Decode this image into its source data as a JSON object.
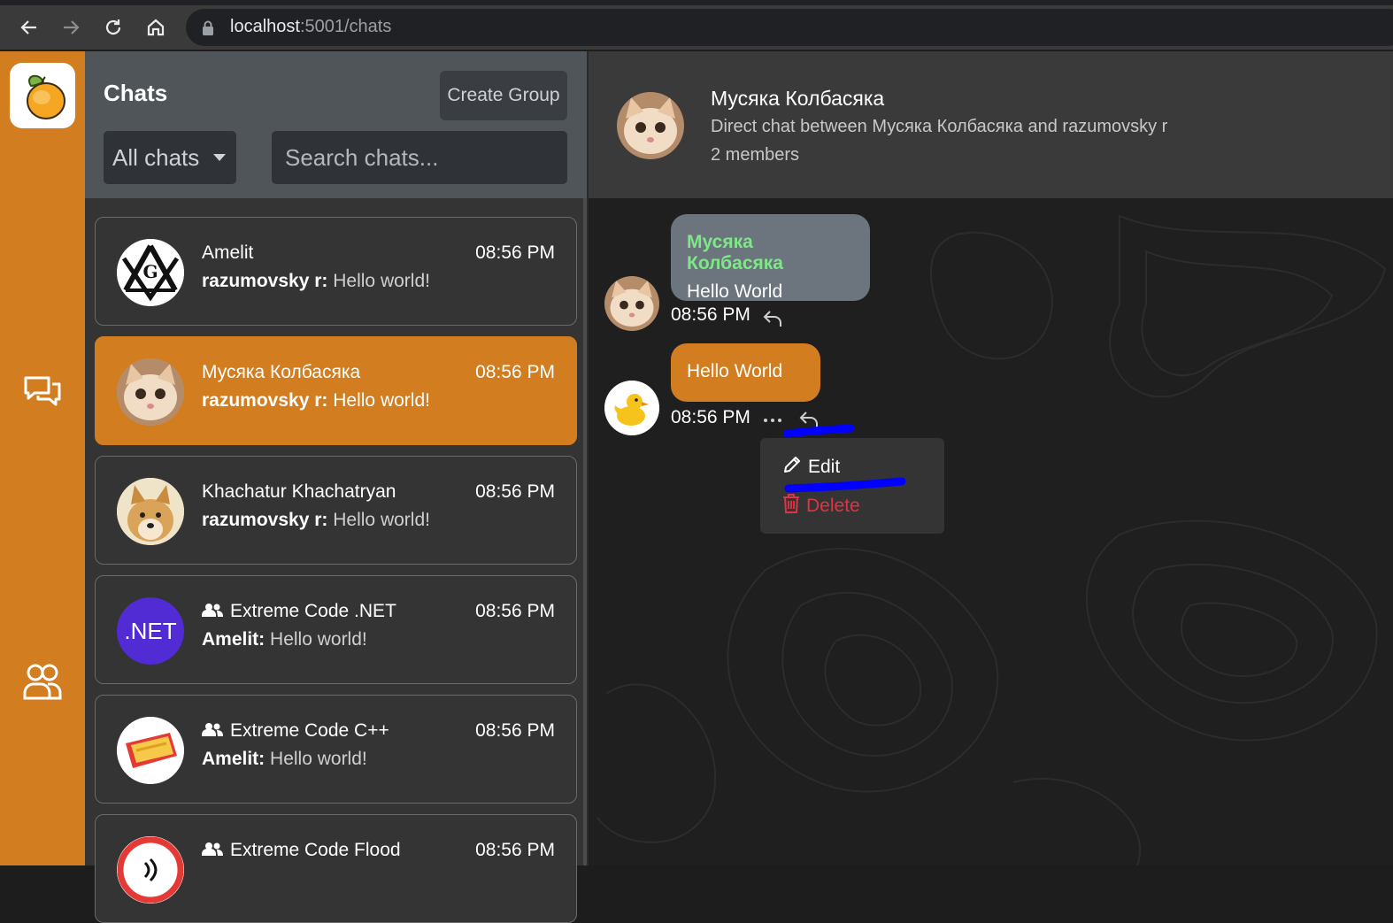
{
  "browser": {
    "url_host": "localhost",
    "url_path": ":5001/chats"
  },
  "sidebar": {
    "logo_icon": "mango-logo",
    "items": [
      {
        "icon": "chat-bubbles-icon"
      },
      {
        "icon": "people-icon"
      }
    ]
  },
  "chats": {
    "title": "Chats",
    "create_group_label": "Create Group",
    "filter_value": "All chats",
    "search_placeholder": "Search chats...",
    "list": [
      {
        "name": "Amelit",
        "time": "08:56 PM",
        "sender": "razumovsky r:",
        "message": "Hello world!",
        "group": false,
        "active": false
      },
      {
        "name": "Мусяка Колбасяка",
        "time": "08:56 PM",
        "sender": "razumovsky r:",
        "message": "Hello world!",
        "group": false,
        "active": true
      },
      {
        "name": "Khachatur Khachatryan",
        "time": "08:56 PM",
        "sender": "razumovsky r:",
        "message": "Hello world!",
        "group": false,
        "active": false
      },
      {
        "name": "Extreme Code .NET",
        "time": "08:56 PM",
        "sender": "Amelit:",
        "message": "Hello world!",
        "group": true,
        "active": false,
        "avatar_text": ".NET"
      },
      {
        "name": "Extreme Code C++",
        "time": "08:56 PM",
        "sender": "Amelit:",
        "message": "Hello world!",
        "group": true,
        "active": false
      },
      {
        "name": "Extreme Code Flood",
        "time": "08:56 PM",
        "group": true,
        "active": false
      }
    ]
  },
  "conversation": {
    "title": "Мусяка Колбасяка",
    "description": "Direct chat between Мусяка Колбасяка and razumovsky r",
    "members": "2 members",
    "messages": [
      {
        "author": "Мусяка Колбасяка",
        "text": "Hello World",
        "time": "08:56 PM",
        "own": false
      },
      {
        "text": "Hello World",
        "time": "08:56 PM",
        "own": true
      }
    ],
    "context_menu": {
      "edit_label": "Edit",
      "delete_label": "Delete"
    }
  },
  "colors": {
    "accent": "#d27d1f",
    "author_name": "#7ee787",
    "danger": "#dc3545",
    "annotation": "#0000ff"
  }
}
